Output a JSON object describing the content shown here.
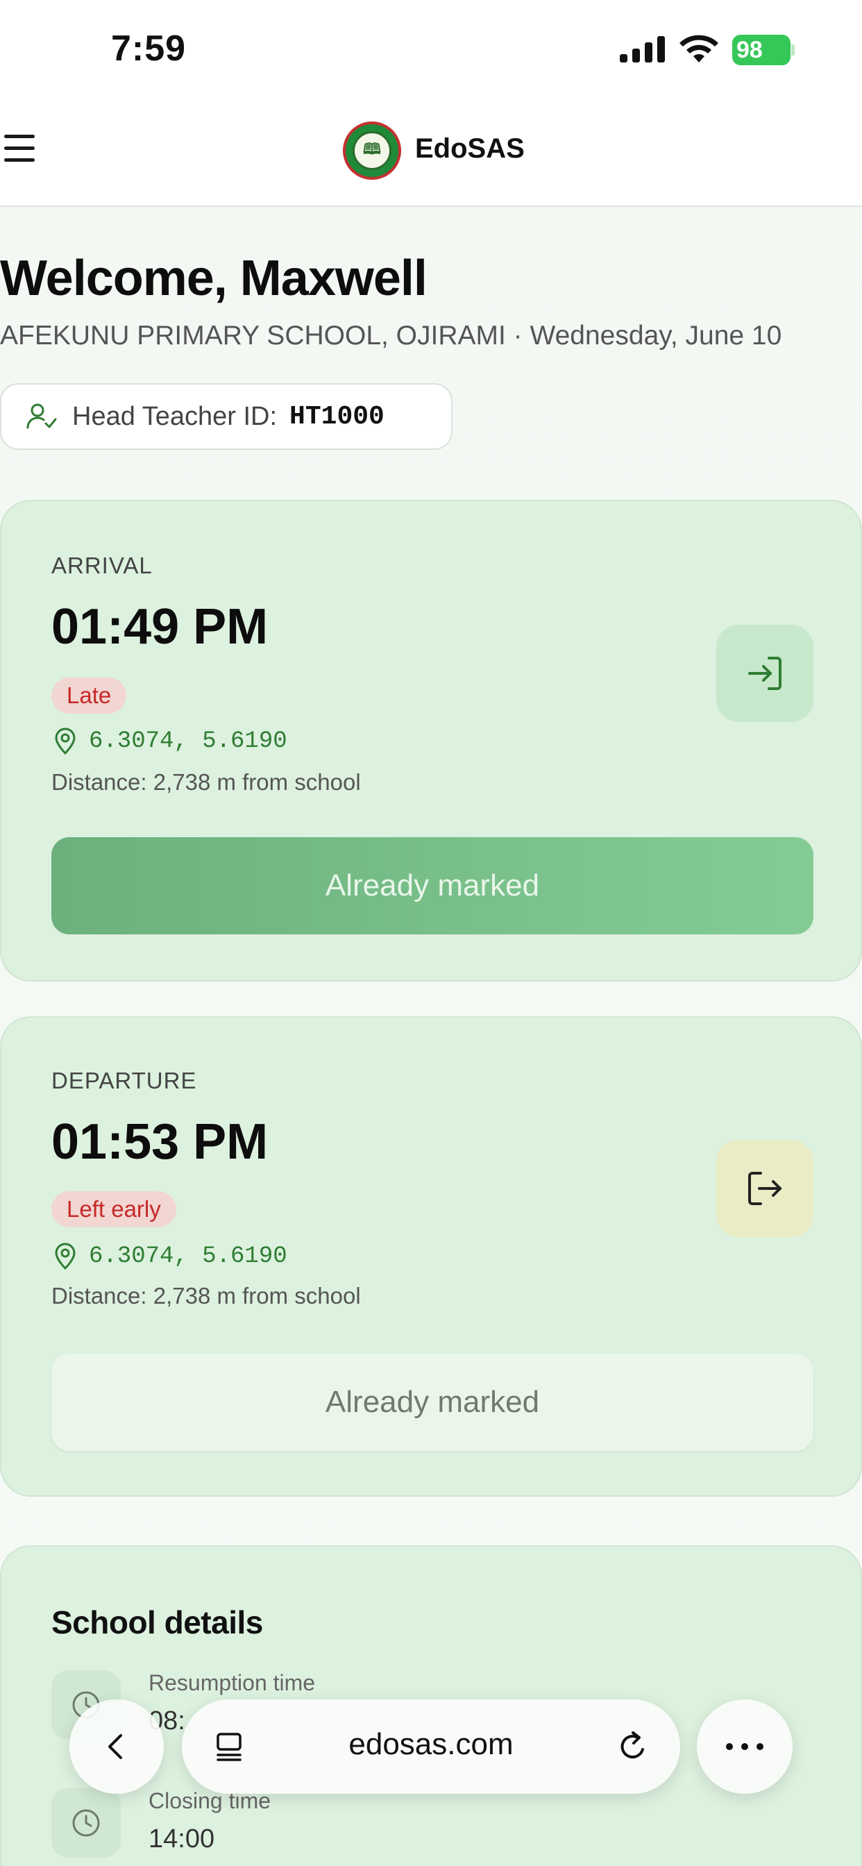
{
  "status_bar": {
    "time": "7:59",
    "battery": "98",
    "icons": [
      "signal-icon",
      "wifi-icon",
      "battery-icon"
    ]
  },
  "header": {
    "app_name": "EdoSAS",
    "icons": [
      "menu-icon",
      "logo"
    ]
  },
  "welcome": {
    "title": "Welcome, Maxwell",
    "subtitle": "AFEKUNU PRIMARY SCHOOL, OJIRAMI · Wednesday, June 10",
    "id_label": "Head Teacher ID:",
    "id_value": "HT1000"
  },
  "arrival": {
    "label": "ARRIVAL",
    "time": "01:49 PM",
    "status": "Late",
    "coords": "6.3074, 5.6190",
    "distance": "Distance: 2,738 m from school",
    "button": "Already marked",
    "icon": "sign-in-icon"
  },
  "departure": {
    "label": "DEPARTURE",
    "time": "01:53 PM",
    "status": "Left early",
    "coords": "6.3074, 5.6190",
    "distance": "Distance: 2,738 m from school",
    "button": "Already marked",
    "icon": "sign-out-icon"
  },
  "school_details": {
    "title": "School details",
    "resumption_label": "Resumption time",
    "resumption_value": "08:",
    "closing_label": "Closing time",
    "closing_value": "14:00"
  },
  "browser": {
    "url": "edosas.com",
    "icons": [
      "back-icon",
      "tabs-icon",
      "reload-icon",
      "more-icon"
    ]
  },
  "colors": {
    "accent": "#2e7d32",
    "card_bg": "#ddf1df",
    "late_badge": "#c62828",
    "button_active": "#6cb07d"
  }
}
